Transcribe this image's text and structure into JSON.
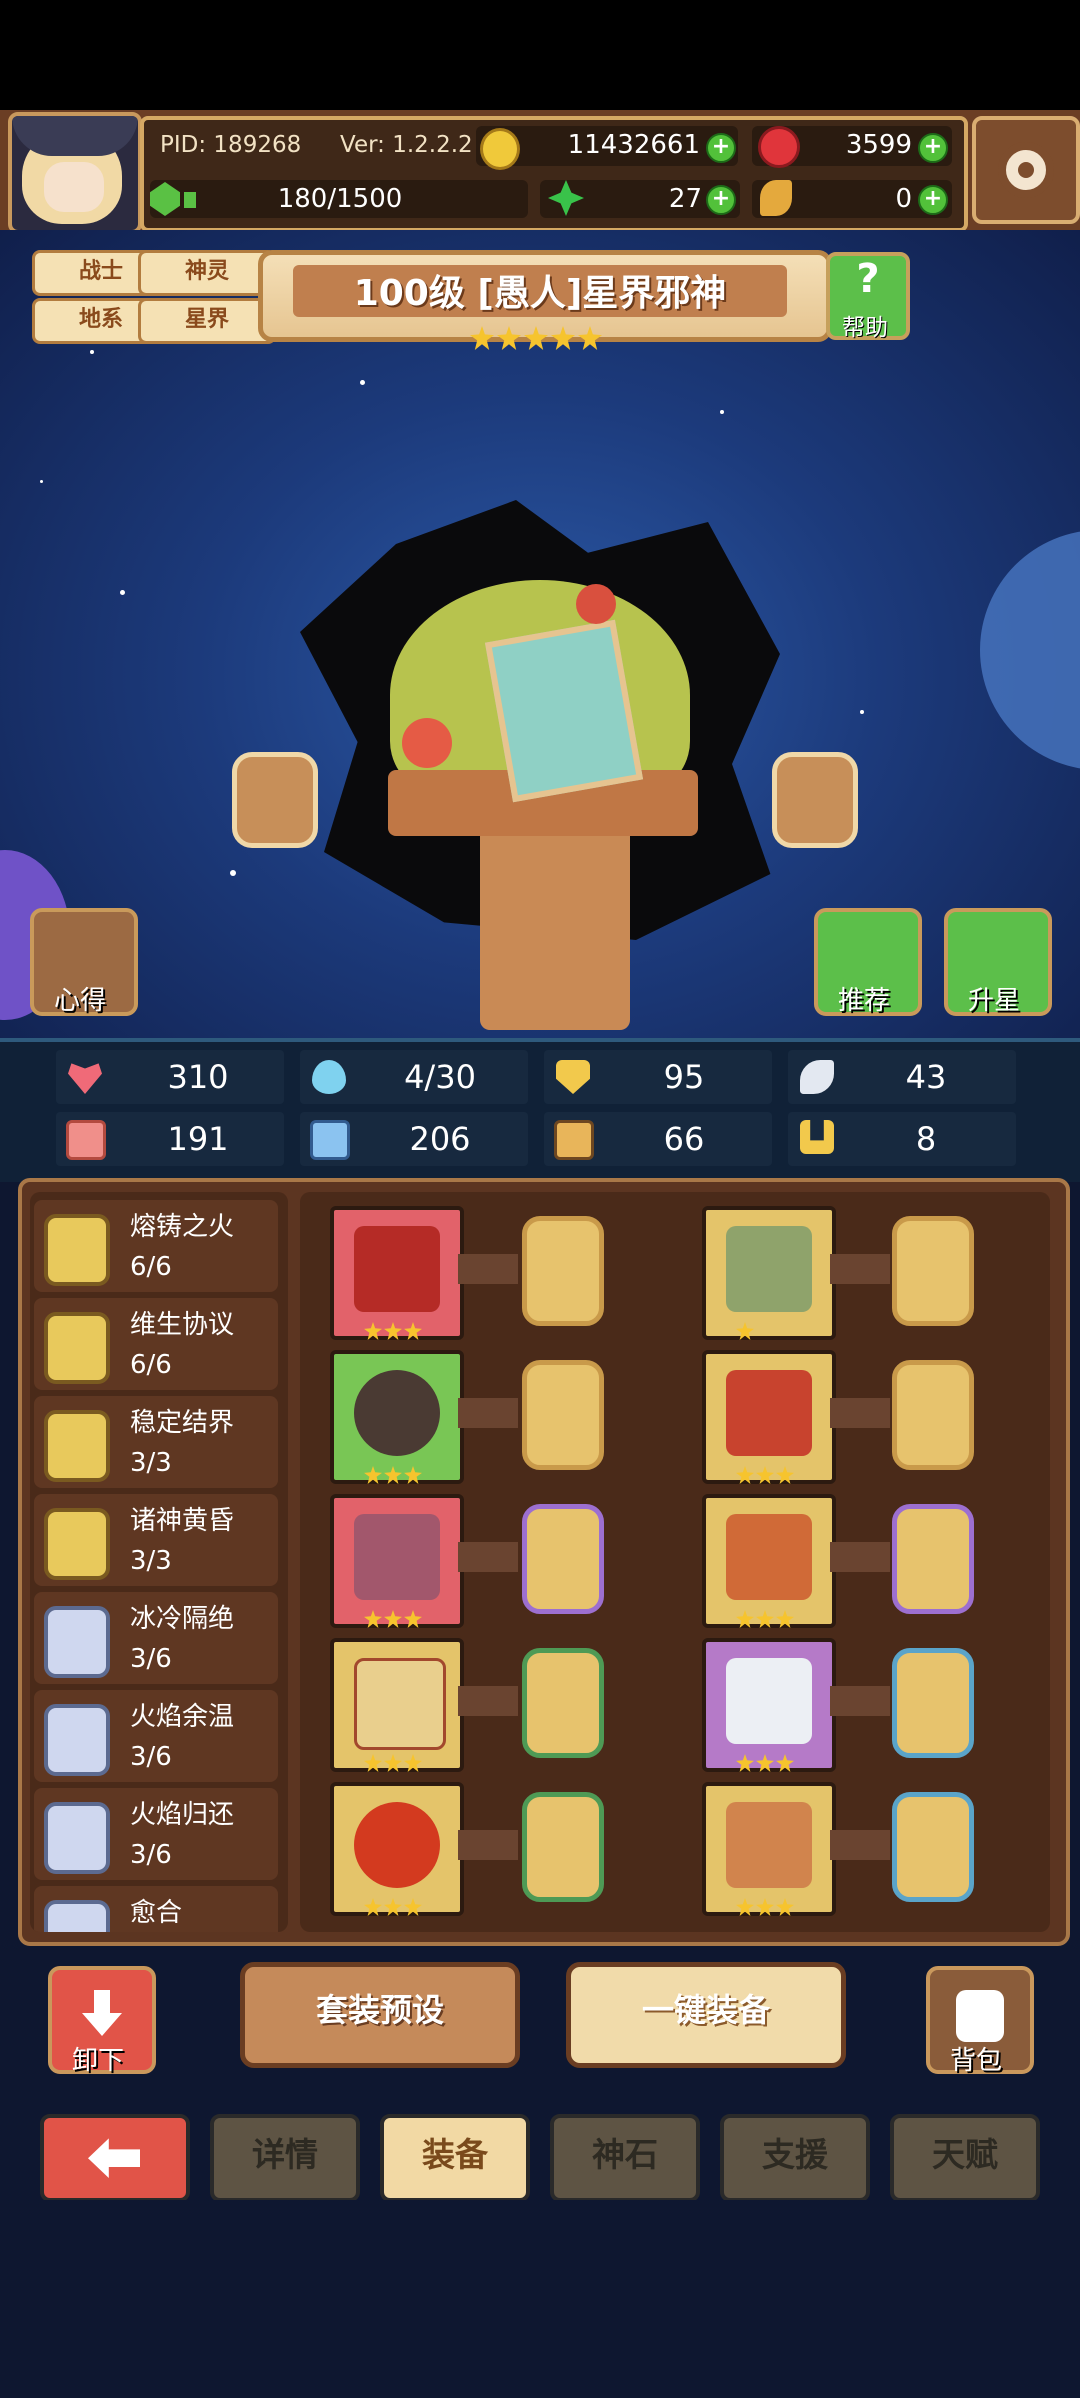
{
  "header": {
    "pid": "PID: 189268",
    "version": "Ver: 1.2.2.2",
    "gold": "11432661",
    "gems": "3599",
    "stamina": "180/1500",
    "clover": "27",
    "feather": "0"
  },
  "tags": [
    "战士",
    "神灵",
    "地系",
    "星界"
  ],
  "title": "100级 [愚人]星界邪神",
  "title_stars": 5,
  "help_label": "帮助",
  "left_button": "心得",
  "right_buttons": [
    "推荐",
    "升星"
  ],
  "stats_row1": [
    "310",
    "4/30",
    "95",
    "43"
  ],
  "stats_row2": [
    "191",
    "206",
    "66",
    "8"
  ],
  "sets": [
    {
      "name": "熔铸之火",
      "count": "6/6"
    },
    {
      "name": "维生协议",
      "count": "6/6"
    },
    {
      "name": "稳定结界",
      "count": "3/3"
    },
    {
      "name": "诸神黄昏",
      "count": "3/3"
    },
    {
      "name": "冰冷隔绝",
      "count": "3/6"
    },
    {
      "name": "火焰余温",
      "count": "3/6"
    },
    {
      "name": "火焰归还",
      "count": "3/6"
    },
    {
      "name": "愈合",
      "count": ""
    }
  ],
  "actions": {
    "unequip": "卸下",
    "preset": "套装预设",
    "equip_all": "一键装备",
    "bag": "背包"
  },
  "tabs": [
    "详情",
    "装备",
    "神石",
    "支援",
    "天赋"
  ],
  "colors": {
    "gold_accent": "#e6c591",
    "active_tab": "#f2d9a4",
    "inactive_tab": "#5e5444",
    "back_button": "#e15448"
  }
}
